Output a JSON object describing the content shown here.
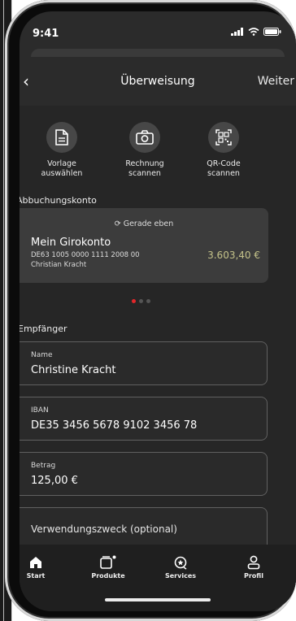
{
  "status_bar": {
    "time": "9:41"
  },
  "nav": {
    "back": "‹",
    "title": "Überweisung",
    "next": "Weiter"
  },
  "actions": [
    {
      "line1": "Vorlage",
      "line2": "auswählen",
      "icon": "document-icon"
    },
    {
      "line1": "Rechnung",
      "line2": "scannen",
      "icon": "camera-icon"
    },
    {
      "line1": "QR-Code",
      "line2": "scannen",
      "icon": "qr-code-icon"
    }
  ],
  "debit": {
    "section_label": "Abbuchungskonto",
    "refresh_text": "Gerade eben",
    "account_name": "Mein Girokonto",
    "iban": "DE63 1005 0000 1111 2008 00",
    "holder": "Christian Kracht",
    "balance": "3.603,40 €",
    "page_count": 3,
    "active_page": 1
  },
  "recipient": {
    "section_label": "Empfänger",
    "name_label": "Name",
    "name_value": "Christine Kracht",
    "iban_label": "IBAN",
    "iban_value": "DE35 3456 5678 9102 3456 78",
    "amount_label": "Betrag",
    "amount_value": "125,00 €",
    "purpose_placeholder": "Verwendungszweck (optional)"
  },
  "tabbar": [
    {
      "label": "Start",
      "icon": "home-icon"
    },
    {
      "label": "Produkte",
      "icon": "wallet-icon"
    },
    {
      "label": "Services",
      "icon": "services-icon"
    },
    {
      "label": "Profil",
      "icon": "profile-icon"
    }
  ],
  "colors": {
    "accent": "#e2262a",
    "balance": "#c4c28a",
    "background": "#262626"
  }
}
